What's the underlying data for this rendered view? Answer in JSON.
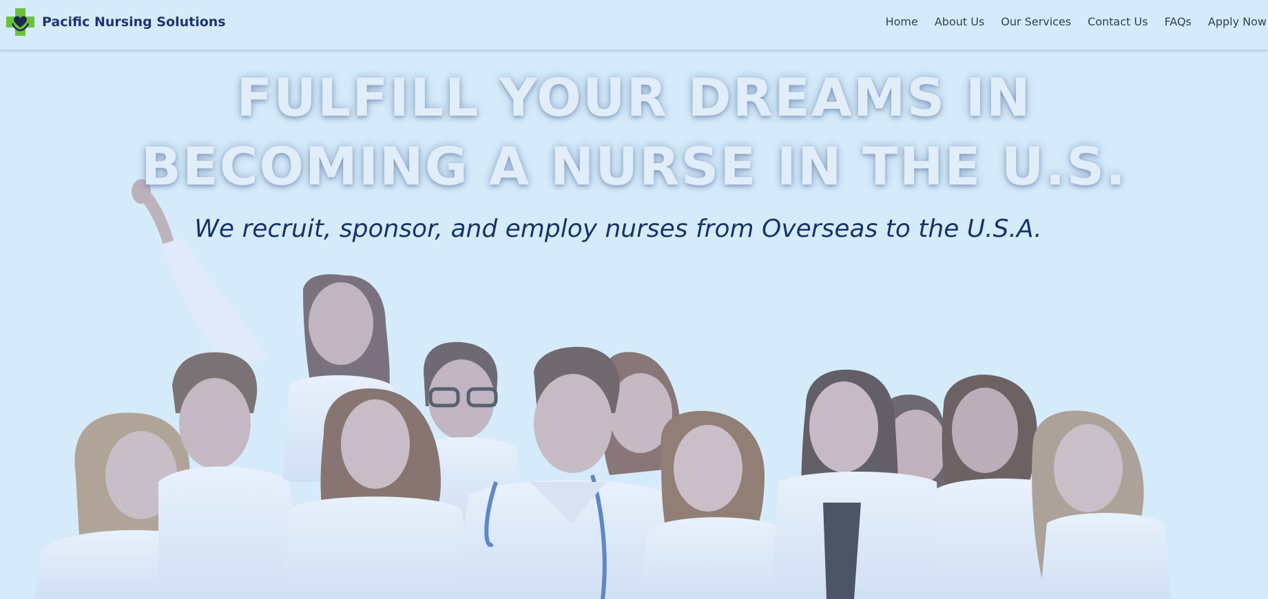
{
  "site": {
    "brand": "Pacific Nursing Solutions",
    "logo_icon": "medical-cross-heart-icon"
  },
  "nav": {
    "items": [
      {
        "label": "Home"
      },
      {
        "label": "About Us"
      },
      {
        "label": "Our Services"
      },
      {
        "label": "Contact Us"
      },
      {
        "label": "FAQs"
      },
      {
        "label": "Apply Now"
      }
    ]
  },
  "hero": {
    "headline_line1": "FULFILL YOUR DREAMS IN",
    "headline_line2": "BECOMING A NURSE IN THE U.S.",
    "tagline": "We recruit, sponsor, and employ nurses from Overseas to the U.S.A."
  },
  "colors": {
    "background": "#d6ebfa",
    "brand_text": "#1c3570",
    "logo_green": "#6bc23a",
    "headline": "#e2edfa",
    "tagline": "#163466"
  }
}
